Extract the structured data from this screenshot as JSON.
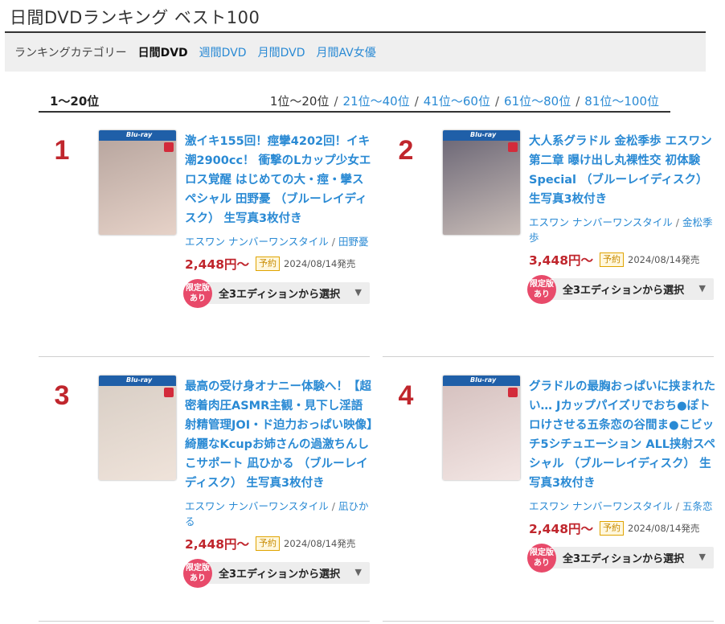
{
  "page": {
    "title": "日間DVDランキング ベスト100"
  },
  "category_bar": {
    "label": "ランキングカテゴリー",
    "current": "日間DVD",
    "links": [
      "週間DVD",
      "月間DVD",
      "月間AV女優"
    ]
  },
  "ranking": {
    "range_label": "1〜20位",
    "pager": {
      "current": "1位〜20位",
      "links": [
        "21位〜40位",
        "41位〜60位",
        "61位〜80位",
        "81位〜100位"
      ]
    }
  },
  "items": [
    {
      "rank": "1",
      "title": "激イキ155回！痙攣4202回！イキ潮2900cc！ 衝撃のLカップ少女エロス覚醒 はじめての大・痙・攣スペシャル 田野憂 （ブルーレイディスク） 生写真3枚付き",
      "maker": "エスワン ナンバーワンスタイル",
      "actress": "田野憂",
      "price": "2,448円〜",
      "reserve_label": "予約",
      "release": "2024/08/14発売",
      "limited_label": "限定版あり",
      "edition_label": "全3エディションから選択",
      "cover_colors": [
        "#b9a7a0",
        "#e6d2c8"
      ]
    },
    {
      "rank": "2",
      "title": "大人系グラドル 金松季歩 エスワン第二章 曝け出し丸裸性交 初体験Special （ブルーレイディスク） 生写真3枚付き",
      "maker": "エスワン ナンバーワンスタイル",
      "actress": "金松季歩",
      "price": "3,448円〜",
      "reserve_label": "予約",
      "release": "2024/08/14発売",
      "limited_label": "限定版あり",
      "edition_label": "全3エディションから選択",
      "cover_colors": [
        "#6f6a78",
        "#c9bdb8"
      ]
    },
    {
      "rank": "3",
      "title": "最高の受け身オナニー体験へ！【超密着肉圧ASMR主観・見下し淫語射精管理JOI・ド迫力おっぱい映像】綺麗なKcupお姉さんの過激ちんしこサポート 凪ひかる （ブルーレイディスク） 生写真3枚付き",
      "maker": "エスワン ナンバーワンスタイル",
      "actress": "凪ひかる",
      "price": "2,448円〜",
      "reserve_label": "予約",
      "release": "2024/08/14発売",
      "limited_label": "限定版あり",
      "edition_label": "全3エディションから選択",
      "cover_colors": [
        "#d9cfc6",
        "#efe3da"
      ]
    },
    {
      "rank": "4",
      "title": "グラドルの最胸おっぱいに挟まれたい… Jカップパイズリでおち●ぽトロけさせる五条恋の谷間ま●こビッチ5シチュエーション ALL挟射スペシャル （ブルーレイディスク） 生写真3枚付き",
      "maker": "エスワン ナンバーワンスタイル",
      "actress": "五条恋",
      "price": "2,448円〜",
      "reserve_label": "予約",
      "release": "2024/08/14発売",
      "limited_label": "限定版あり",
      "edition_label": "全3エディションから選択",
      "cover_colors": [
        "#d6c2c0",
        "#f3e6e4"
      ]
    }
  ]
}
